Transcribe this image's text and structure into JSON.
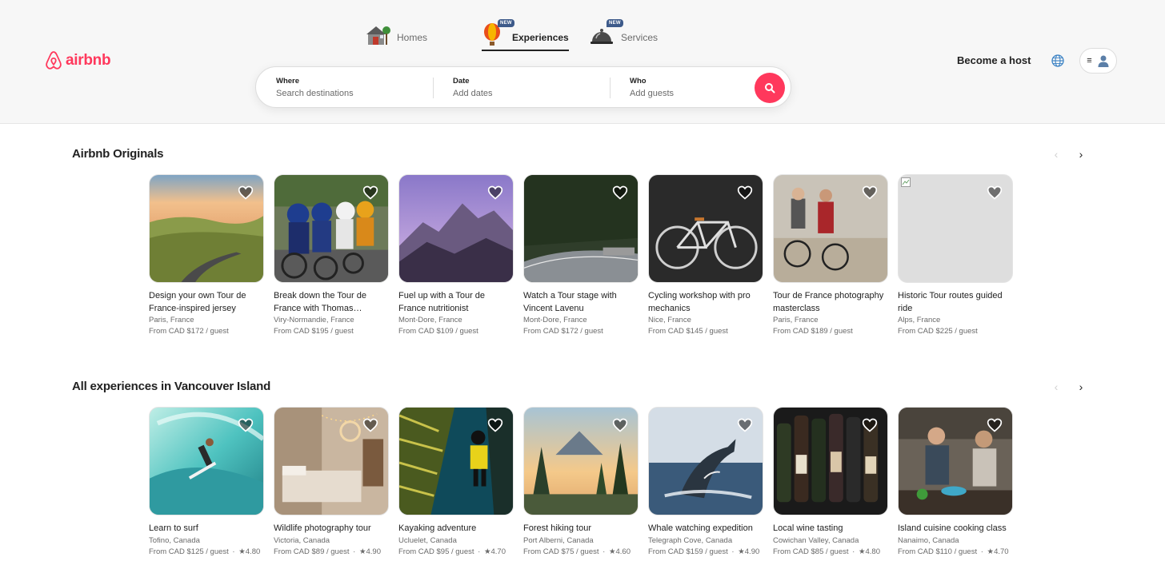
{
  "brand": {
    "name": "airbnb",
    "color": "#ff385c"
  },
  "nav": {
    "tabs": [
      {
        "label": "Homes",
        "icon": "house-icon",
        "active": false,
        "badge": ""
      },
      {
        "label": "Experiences",
        "icon": "hot-air-balloon-icon",
        "active": true,
        "badge": "NEW"
      },
      {
        "label": "Services",
        "icon": "service-bell-icon",
        "active": false,
        "badge": "NEW"
      }
    ]
  },
  "header": {
    "host_label": "Become a host",
    "globe_icon": "globe-icon",
    "menu_icon": "hamburger-icon",
    "avatar_icon": "user-avatar-icon"
  },
  "search": {
    "where_label": "Where",
    "where_placeholder": "Search destinations",
    "date_label": "Date",
    "date_placeholder": "Add dates",
    "who_label": "Who",
    "who_placeholder": "Add guests",
    "button_icon": "search-icon"
  },
  "sections": [
    {
      "title": "Airbnb Originals",
      "cards": [
        {
          "title": "Design your own Tour de France-inspired jersey",
          "location": "Paris, France",
          "price": "From CAD $172 / guest",
          "rating": ""
        },
        {
          "title": "Break down the Tour de France with Thomas…",
          "location": "Viry-Normandie, France",
          "price": "From CAD $195 / guest",
          "rating": ""
        },
        {
          "title": "Fuel up with a Tour de France nutritionist",
          "location": "Mont-Dore, France",
          "price": "From CAD $109 / guest",
          "rating": ""
        },
        {
          "title": "Watch a Tour stage with Vincent Lavenu",
          "location": "Mont-Dore, France",
          "price": "From CAD $172 / guest",
          "rating": ""
        },
        {
          "title": "Cycling workshop with pro mechanics",
          "location": "Nice, France",
          "price": "From CAD $145 / guest",
          "rating": ""
        },
        {
          "title": "Tour de France photography masterclass",
          "location": "Paris, France",
          "price": "From CAD $189 / guest",
          "rating": ""
        },
        {
          "title": "Historic Tour routes guided ride",
          "location": "Alps, France",
          "price": "From CAD $225 / guest",
          "rating": ""
        }
      ]
    },
    {
      "title": "All experiences in Vancouver Island",
      "cards": [
        {
          "title": "Learn to surf",
          "location": "Tofino, Canada",
          "price": "From CAD $125 / guest",
          "rating": "★4.80"
        },
        {
          "title": "Wildlife photography tour",
          "location": "Victoria, Canada",
          "price": "From CAD $89 / guest",
          "rating": "★4.90"
        },
        {
          "title": "Kayaking adventure",
          "location": "Ucluelet, Canada",
          "price": "From CAD $95 / guest",
          "rating": "★4.70"
        },
        {
          "title": "Forest hiking tour",
          "location": "Port Alberni, Canada",
          "price": "From CAD $75 / guest",
          "rating": "★4.60"
        },
        {
          "title": "Whale watching expedition",
          "location": "Telegraph Cove, Canada",
          "price": "From CAD $159 / guest",
          "rating": "★4.90"
        },
        {
          "title": "Local wine tasting",
          "location": "Cowichan Valley, Canada",
          "price": "From CAD $85 / guest",
          "rating": "★4.80"
        },
        {
          "title": "Island cuisine cooking class",
          "location": "Nanaimo, Canada",
          "price": "From CAD $110 / guest",
          "rating": "★4.70"
        }
      ]
    }
  ]
}
